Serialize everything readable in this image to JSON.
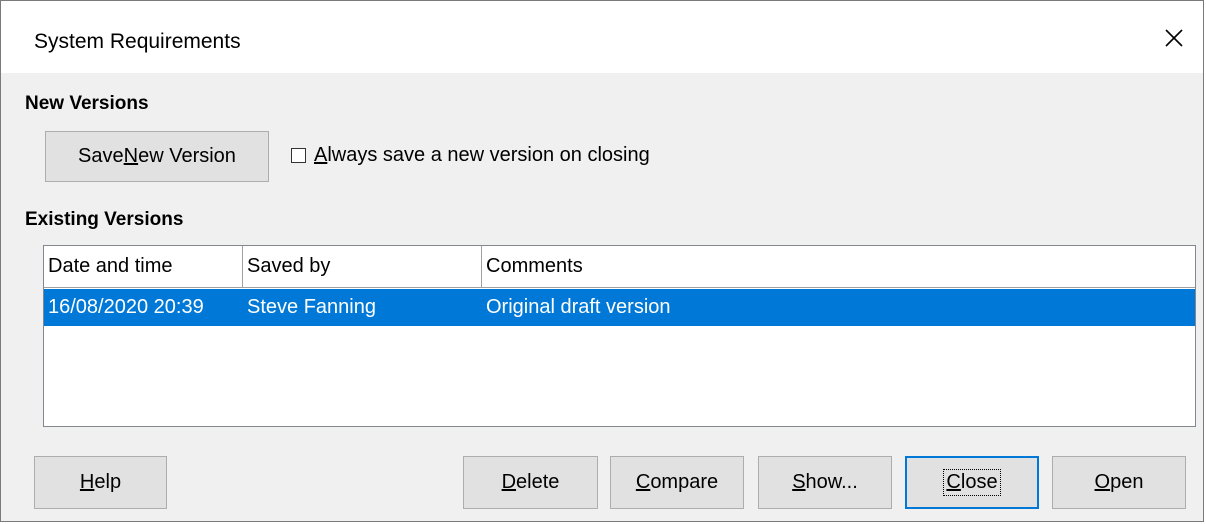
{
  "dialog": {
    "title": "System Requirements",
    "close_icon": "close-icon"
  },
  "new_versions": {
    "heading": "New Versions",
    "save_button": {
      "pre": "Save ",
      "mnemonic": "N",
      "post": "ew Version"
    },
    "always_save": {
      "checked": false,
      "mnemonic": "A",
      "post": "lways save a new version on closing"
    }
  },
  "existing_versions": {
    "heading": "Existing Versions",
    "columns": [
      "Date and time",
      "Saved by",
      "Comments"
    ],
    "rows": [
      {
        "date": "16/08/2020 20:39",
        "saved_by": "Steve Fanning",
        "comment": "Original draft version",
        "selected": true
      }
    ]
  },
  "buttons": {
    "help": {
      "mnemonic": "H",
      "post": "elp"
    },
    "delete": {
      "mnemonic": "D",
      "post": "elete"
    },
    "compare": {
      "mnemonic": "C",
      "post": "ompare"
    },
    "show": {
      "mnemonic": "S",
      "post": "how..."
    },
    "close": {
      "mnemonic": "C",
      "post": "lose"
    },
    "open": {
      "mnemonic": "O",
      "post": "pen"
    }
  },
  "colors": {
    "selection": "#0078d7",
    "dialog_bg": "#f0f0f0",
    "button_bg": "#e1e1e1"
  }
}
